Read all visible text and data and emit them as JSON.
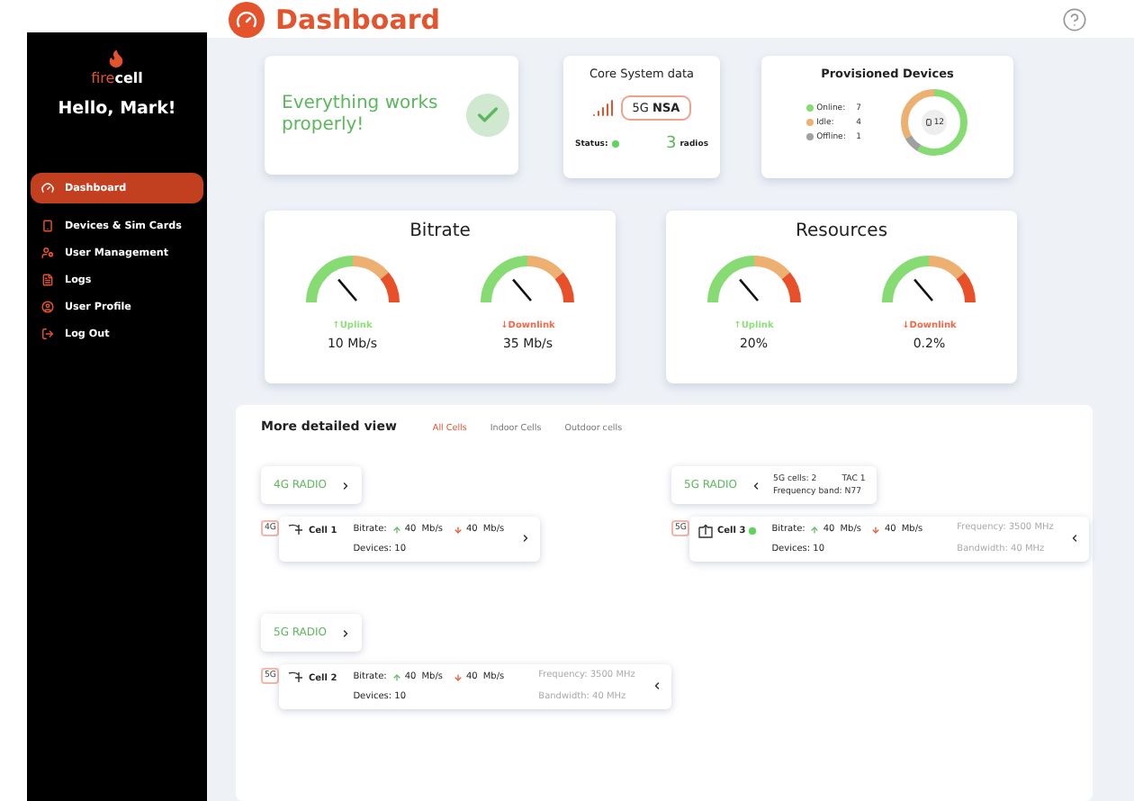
{
  "sidebar": {
    "logo": {
      "part_1": "fire",
      "part_2": "cell"
    },
    "greeting": "Hello, Mark!",
    "items": [
      {
        "label": "Dashboard",
        "selected": true
      },
      {
        "label": "Devices & Sim Cards",
        "selected": false
      },
      {
        "label": "User Management",
        "selected": false
      },
      {
        "label": "Logs",
        "selected": false
      },
      {
        "label": "User Profile",
        "selected": false
      },
      {
        "label": "Log Out",
        "selected": false
      }
    ]
  },
  "header": {
    "title": "Dashboard"
  },
  "status_card": {
    "message": "Everything works properly!",
    "ok": true
  },
  "core_system": {
    "title": "Core System data",
    "mode": "5G **NSA**",
    "status_label": "Status:",
    "status_online": true,
    "radio_count": "3",
    "radio_label": "radios"
  },
  "provisioned": {
    "title": "Provisioned Devices",
    "total": "12",
    "items": [
      {
        "label": "Online:",
        "count": "7",
        "color": "#86dc72"
      },
      {
        "label": "Idle:",
        "count": "4",
        "color": "#eeb070"
      },
      {
        "label": "Offline:",
        "count": "1",
        "color": "#a0a0a0"
      }
    ]
  },
  "meter_cards": [
    {
      "title": "Bitrate",
      "meters": [
        {
          "label": "↑Uplink",
          "kind": "up",
          "value": "10 Mb/s"
        },
        {
          "label": "↓Downlink",
          "kind": "down",
          "value": "35 Mb/s"
        }
      ]
    },
    {
      "title": "Resources",
      "meters": [
        {
          "label": "↑Uplink",
          "kind": "up",
          "value": "20%"
        },
        {
          "label": "↓Downlink",
          "kind": "down",
          "value": "0.2%"
        }
      ]
    }
  ],
  "details": {
    "title": "More detailed view",
    "tabs": [
      {
        "label": "All Cells",
        "selected": true
      },
      {
        "label": "Indoor Cells",
        "selected": false
      },
      {
        "label": "Outdoor cells",
        "selected": false
      }
    ],
    "columns": [
      [
        {
          "radio": {
            "label": "4G RADIO",
            "expanded": false
          },
          "cells": [
            {
              "tag": "4G",
              "kind": "antenna",
              "name": "Cell 1",
              "online": false,
              "bitrate_label": "Bitrate:",
              "up": "40",
              "up_unit": "Mb/s",
              "down": "40",
              "down_unit": "Mb/s",
              "devices": "Devices: 10",
              "expanded": false
            }
          ]
        },
        {
          "radio": {
            "label": "5G RADIO",
            "expanded": false
          },
          "cells": [
            {
              "tag": "5G",
              "kind": "antenna",
              "name": "Cell 2",
              "online": false,
              "bitrate_label": "Bitrate:",
              "up": "40",
              "up_unit": "Mb/s",
              "down": "40",
              "down_unit": "Mb/s",
              "devices": "Devices: 10",
              "frequency": "Frequency: 3500 MHz",
              "bandwidth": "Bandwidth: 40 MHz",
              "expanded": true
            }
          ]
        }
      ],
      [
        {
          "radio": {
            "label": "5G RADIO",
            "expanded": true,
            "cell_count": "5G cells: 2",
            "tac": "TAC 1",
            "band": "Frequency band: N77"
          },
          "cells": [
            {
              "tag": "5G",
              "kind": "box",
              "name": "Cell 3",
              "online": true,
              "bitrate_label": "Bitrate:",
              "up": "40",
              "up_unit": "Mb/s",
              "down": "40",
              "down_unit": "Mb/s",
              "devices": "Devices: 10",
              "frequency": "Frequency: 3500 MHz",
              "bandwidth": "Bandwidth: 40 MHz",
              "expanded": true
            }
          ]
        }
      ]
    ]
  }
}
